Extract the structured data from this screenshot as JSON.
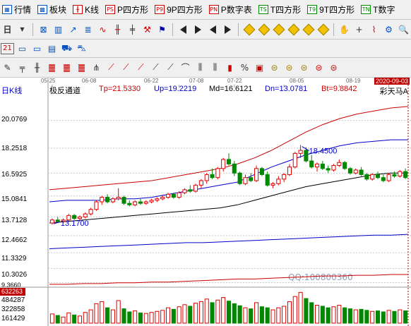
{
  "menubar": {
    "items": [
      {
        "icon": "grid-icon",
        "label": "行情"
      },
      {
        "icon": "blocks-icon",
        "label": "板块"
      },
      {
        "icon": "kline-icon",
        "label": "K线"
      },
      {
        "icon_text": "PS",
        "label": "P四方形"
      },
      {
        "icon_text": "P9",
        "label": "9P四方形"
      },
      {
        "icon_text": "PN",
        "label": "P数字表"
      },
      {
        "icon_text": "TS",
        "label": "T四方形"
      },
      {
        "icon_text": "T9",
        "label": "9T四方形"
      },
      {
        "icon_text": "TN",
        "label": "T数字"
      }
    ]
  },
  "chart": {
    "title": "日K线",
    "indicator": "极反通道",
    "params": {
      "tp": "Tp=21.5330",
      "up": "Up=19.2219",
      "md": "Md=16.6121",
      "dn": "Dn=13.0781",
      "bt": "Bt=9.8842"
    },
    "right_date": "2020-09-03",
    "right_label": "彩天马A",
    "price_ticks": [
      "20.0769",
      "18.2518",
      "16.5925",
      "15.0841",
      "13.7128",
      "12.4662",
      "11.3329",
      "10.3026",
      "9.3660"
    ],
    "volume_ticks": [
      "484287",
      "322858",
      "161429"
    ],
    "volume_current": "632263",
    "dates": [
      "05-25",
      "06-08",
      "06-22",
      "07-08",
      "07-22",
      "08-05",
      "08-19"
    ],
    "high_marker": "18.4500",
    "low_marker": "13.1700",
    "watermark": "QQ:100800360",
    "colors": {
      "up": "#e00000",
      "down": "#008800",
      "channel_top": "#cc0000",
      "channel_mid": "#0000cc",
      "ma": "#000000"
    }
  },
  "chart_data": {
    "type": "candlestick",
    "ylim": [
      9.2,
      21.6
    ],
    "candles": [
      [
        13.3,
        13.6,
        13.2,
        13.5
      ],
      [
        13.5,
        13.7,
        13.3,
        13.4
      ],
      [
        13.4,
        13.6,
        13.3,
        13.5
      ],
      [
        13.5,
        13.9,
        13.4,
        13.8
      ],
      [
        13.8,
        13.9,
        13.5,
        13.6
      ],
      [
        13.6,
        13.8,
        13.5,
        13.7
      ],
      [
        13.7,
        14.0,
        13.6,
        13.9
      ],
      [
        13.9,
        14.3,
        13.8,
        14.2
      ],
      [
        14.2,
        14.8,
        14.1,
        14.7
      ],
      [
        14.7,
        15.1,
        14.5,
        15.0
      ],
      [
        15.0,
        15.2,
        14.6,
        14.7
      ],
      [
        14.7,
        15.0,
        14.6,
        14.9
      ],
      [
        14.9,
        15.6,
        14.8,
        15.0
      ],
      [
        15.0,
        15.1,
        14.5,
        14.6
      ],
      [
        14.6,
        14.8,
        14.4,
        14.5
      ],
      [
        14.5,
        14.8,
        14.4,
        14.7
      ],
      [
        14.7,
        14.9,
        14.5,
        14.6
      ],
      [
        14.6,
        14.8,
        14.5,
        14.7
      ],
      [
        14.7,
        14.9,
        14.6,
        14.8
      ],
      [
        14.8,
        15.0,
        14.7,
        14.9
      ],
      [
        14.9,
        15.1,
        14.8,
        15.0
      ],
      [
        15.0,
        15.3,
        14.9,
        15.2
      ],
      [
        15.2,
        15.3,
        14.9,
        15.0
      ],
      [
        15.0,
        15.4,
        14.9,
        15.3
      ],
      [
        15.3,
        15.6,
        15.2,
        15.5
      ],
      [
        15.5,
        15.8,
        15.3,
        15.4
      ],
      [
        15.4,
        15.9,
        15.3,
        15.8
      ],
      [
        15.8,
        16.2,
        15.6,
        16.1
      ],
      [
        16.1,
        16.6,
        15.9,
        16.5
      ],
      [
        16.5,
        16.9,
        16.2,
        16.3
      ],
      [
        16.3,
        17.0,
        16.2,
        16.9
      ],
      [
        16.9,
        17.6,
        16.7,
        17.5
      ],
      [
        17.5,
        17.9,
        17.1,
        17.2
      ],
      [
        17.2,
        17.4,
        16.4,
        16.6
      ],
      [
        16.6,
        16.7,
        15.8,
        15.9
      ],
      [
        15.9,
        16.5,
        15.8,
        16.3
      ],
      [
        16.3,
        16.6,
        16.0,
        16.1
      ],
      [
        16.1,
        17.1,
        16.0,
        16.9
      ],
      [
        16.9,
        17.0,
        16.4,
        16.5
      ],
      [
        16.5,
        16.7,
        15.7,
        15.8
      ],
      [
        15.8,
        16.0,
        15.6,
        15.9
      ],
      [
        15.9,
        16.4,
        15.8,
        16.2
      ],
      [
        16.2,
        16.6,
        16.0,
        16.5
      ],
      [
        16.5,
        17.2,
        16.4,
        17.0
      ],
      [
        17.0,
        18.0,
        16.9,
        17.9
      ],
      [
        17.9,
        18.45,
        17.6,
        18.1
      ],
      [
        18.1,
        18.3,
        17.3,
        17.4
      ],
      [
        17.4,
        17.8,
        16.9,
        17.0
      ],
      [
        17.0,
        17.3,
        16.7,
        17.2
      ],
      [
        17.2,
        17.4,
        16.8,
        16.9
      ],
      [
        16.9,
        17.1,
        16.6,
        16.8
      ],
      [
        16.8,
        17.2,
        16.7,
        17.1
      ],
      [
        17.1,
        17.5,
        17.0,
        17.3
      ],
      [
        17.3,
        17.4,
        16.8,
        16.9
      ],
      [
        16.9,
        17.0,
        16.5,
        16.6
      ],
      [
        16.6,
        16.9,
        16.5,
        16.8
      ],
      [
        16.8,
        17.0,
        16.4,
        16.5
      ],
      [
        16.5,
        16.6,
        16.1,
        16.2
      ],
      [
        16.2,
        16.6,
        16.1,
        16.5
      ],
      [
        16.5,
        16.7,
        16.2,
        16.3
      ],
      [
        16.3,
        16.5,
        16.0,
        16.1
      ],
      [
        16.1,
        16.6,
        16.0,
        16.5
      ],
      [
        16.5,
        16.7,
        16.3,
        16.4
      ],
      [
        16.4,
        16.8,
        16.3,
        16.7
      ],
      [
        16.7,
        16.9,
        16.2,
        16.3
      ]
    ],
    "channel_top": [
      15.5,
      15.6,
      15.7,
      15.8,
      15.9,
      16.0,
      16.1,
      16.3,
      16.5,
      16.7,
      16.9,
      17.2,
      17.6,
      18.1,
      18.7,
      19.3,
      19.8,
      20.2,
      20.5,
      20.7,
      20.9,
      21.0
    ],
    "channel_up": [
      14.7,
      14.8,
      14.8,
      14.8,
      14.9,
      14.9,
      15.0,
      15.2,
      15.4,
      15.6,
      15.8,
      16.0,
      16.5,
      17.0,
      17.4,
      17.8,
      18.1,
      18.4,
      18.6,
      18.7,
      18.8,
      18.8
    ],
    "ma": [
      13.3,
      13.4,
      13.5,
      13.6,
      13.7,
      13.8,
      13.9,
      14.0,
      14.1,
      14.2,
      14.3,
      14.5,
      14.8,
      15.1,
      15.4,
      15.7,
      15.9,
      16.1,
      16.3,
      16.5,
      16.6,
      16.6
    ],
    "channel_dn": [
      11.6,
      11.65,
      11.7,
      11.75,
      11.8,
      11.85,
      11.9,
      11.95,
      12.0,
      12.0,
      12.05,
      12.1,
      12.15,
      12.2,
      12.25,
      12.3,
      12.35,
      12.4,
      12.45,
      12.5,
      12.5,
      12.55
    ],
    "channel_bt": [
      9.25,
      9.25,
      9.3,
      9.3,
      9.35,
      9.35,
      9.4,
      9.4,
      9.45,
      9.5,
      9.55,
      9.6,
      9.6,
      9.65,
      9.7,
      9.75,
      9.8,
      9.8,
      9.85,
      9.85,
      9.9,
      9.9
    ],
    "volume_ylim": [
      0,
      632263
    ],
    "volumes": [
      180000,
      150000,
      120000,
      200000,
      160000,
      140000,
      210000,
      260000,
      380000,
      420000,
      300000,
      260000,
      440000,
      280000,
      220000,
      240000,
      200000,
      190000,
      210000,
      230000,
      250000,
      300000,
      270000,
      320000,
      360000,
      330000,
      390000,
      420000,
      470000,
      400000,
      450000,
      500000,
      430000,
      380000,
      340000,
      300000,
      280000,
      400000,
      320000,
      300000,
      260000,
      300000,
      330000,
      420000,
      520000,
      600000,
      480000,
      400000,
      350000,
      330000,
      300000,
      320000,
      350000,
      300000,
      280000,
      260000,
      270000,
      250000,
      230000,
      240000,
      220000,
      250000,
      230000,
      260000,
      240000
    ]
  }
}
